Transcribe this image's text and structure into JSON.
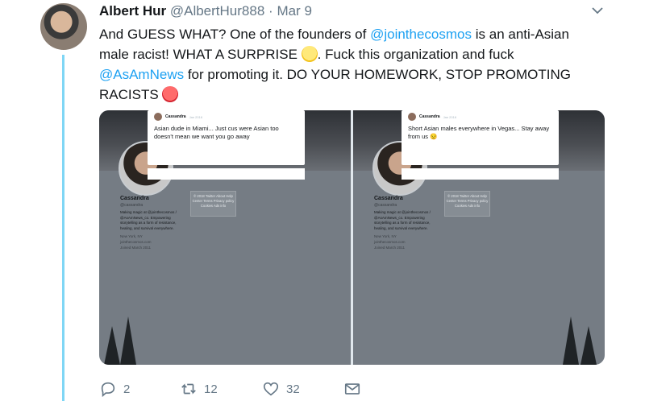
{
  "tweet": {
    "display_name": "Albert Hur",
    "handle": "@AlbertHur888",
    "separator": "·",
    "date": "Mar 9",
    "text": {
      "p1": "And GUESS WHAT?  One of the founders of ",
      "link1": "@jointhecosmos",
      "p2": " is an anti-Asian male racist!  WHAT A SURPRISE ",
      "p3": ". Fuck this organization and fuck ",
      "link2": "@AsAmNews",
      "p4": " for promoting it.  DO YOUR HOMEWORK, STOP PROMOTING RACISTS "
    }
  },
  "media": {
    "left": {
      "overlay_name": "Cassandra",
      "overlay_date": "Jan 2016",
      "overlay_text": "Asian dude in Miami... Just cus were Asian too doesn't mean we want you go away",
      "profile_name": "Cassandra",
      "profile_handle": "@cassandra",
      "bio": "Making magic at @jointhecosmos / @AsAmNews_co. Empowering storytelling as a form of resistance, healing, and survival everywhere.",
      "location": "New York, NY",
      "site": "jointhecosmos.com",
      "joined": "Joined March 2011",
      "footer": "© 2018 Twitter  About  Help Center  Terms  Privacy policy  Cookies  Ads info"
    },
    "right": {
      "overlay_name": "Cassandra",
      "overlay_date": "Jan 2016",
      "overlay_text": "Short Asian males everywhere in Vegas... Stay away from us 😒",
      "profile_name": "Cassandra",
      "profile_handle": "@cassandra",
      "bio": "Making magic at @jointhecosmos / @AsAmNews_co. Empowering storytelling as a form of resistance, healing, and survival everywhere.",
      "location": "New York, NY",
      "site": "jointhecosmos.com",
      "joined": "Joined March 2011",
      "footer": "© 2018 Twitter  About  Help Center  Terms  Privacy policy  Cookies  Ads info"
    }
  },
  "actions": {
    "replies": "2",
    "retweets": "12",
    "likes": "32"
  },
  "icons": {
    "caret": "chevron-down-icon",
    "reply": "reply-icon",
    "retweet": "retweet-icon",
    "like": "heart-icon",
    "dm": "envelope-icon",
    "emoji1": "face-with-rolling-eyes-icon",
    "emoji2": "angry-face-icon"
  },
  "colors": {
    "link": "#1da1f2",
    "thread_line": "#7fd6f5",
    "meta": "#657786"
  }
}
